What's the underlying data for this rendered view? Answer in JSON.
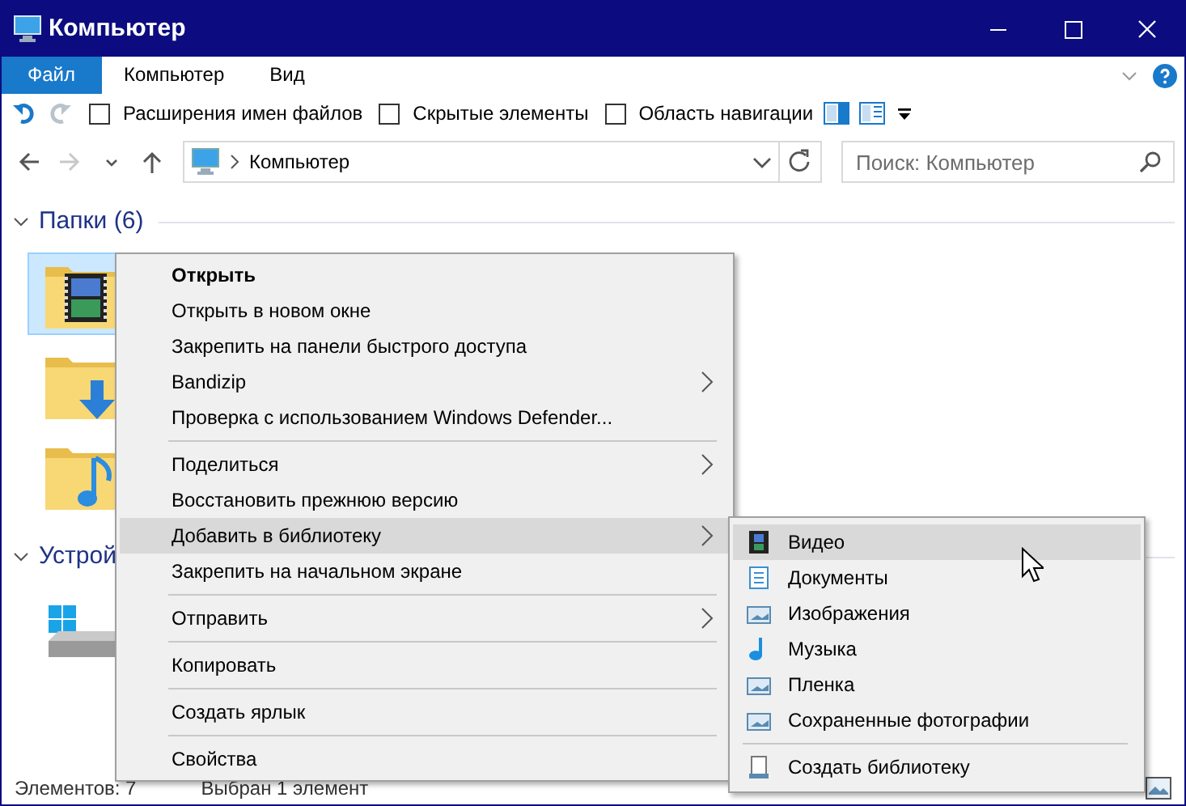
{
  "window": {
    "title": "Компьютер"
  },
  "ribbon_tabs": [
    {
      "label": "Файл",
      "selected": true
    },
    {
      "label": "Компьютер",
      "selected": false
    },
    {
      "label": "Вид",
      "selected": false
    }
  ],
  "quick_actions": [
    {
      "kind": "undo",
      "disabled": false
    },
    {
      "kind": "redo",
      "disabled": true
    }
  ],
  "view_options": [
    {
      "label": "Расширения имен файлов",
      "checked": false
    },
    {
      "label": "Скрытые элементы",
      "checked": false
    },
    {
      "label": "Область навигации",
      "checked": false
    }
  ],
  "nav_buttons": [
    {
      "kind": "back",
      "disabled": false
    },
    {
      "kind": "forward",
      "disabled": true
    },
    {
      "kind": "recent",
      "disabled": false
    },
    {
      "kind": "up",
      "disabled": false
    }
  ],
  "address": {
    "path": "Компьютер"
  },
  "search": {
    "placeholder": "Поиск: Компьютер"
  },
  "groups": [
    {
      "title": "Папки (6)",
      "items": [
        {
          "kind": "video",
          "selected": true
        },
        {
          "kind": "downloads",
          "selected": false
        },
        {
          "kind": "music",
          "selected": false
        }
      ]
    },
    {
      "title": "Устрой",
      "items": [
        {
          "kind": "drive",
          "selected": false
        }
      ]
    }
  ],
  "status_bar": {
    "count": "Элементов: 7",
    "selection": "Выбран 1 элемент"
  },
  "context_menu": [
    {
      "kind": "item",
      "label": "Открыть",
      "default": true,
      "submenu": false,
      "selected": false
    },
    {
      "kind": "item",
      "label": "Открыть в новом окне",
      "default": false,
      "submenu": false,
      "selected": false
    },
    {
      "kind": "item",
      "label": "Закрепить на панели быстрого доступа",
      "default": false,
      "submenu": false,
      "selected": false
    },
    {
      "kind": "item",
      "label": "Bandizip",
      "default": false,
      "submenu": true,
      "selected": false
    },
    {
      "kind": "item",
      "label": "Проверка с использованием Windows Defender...",
      "default": false,
      "submenu": false,
      "selected": false
    },
    {
      "kind": "separator"
    },
    {
      "kind": "item",
      "label": "Поделиться",
      "default": false,
      "submenu": true,
      "selected": false
    },
    {
      "kind": "item",
      "label": "Восстановить прежнюю версию",
      "default": false,
      "submenu": false,
      "selected": false
    },
    {
      "kind": "item",
      "label": "Добавить в библиотеку",
      "default": false,
      "submenu": true,
      "selected": true
    },
    {
      "kind": "item",
      "label": "Закрепить на начальном экране",
      "default": false,
      "submenu": false,
      "selected": false
    },
    {
      "kind": "separator"
    },
    {
      "kind": "item",
      "label": "Отправить",
      "default": false,
      "submenu": true,
      "selected": false
    },
    {
      "kind": "separator"
    },
    {
      "kind": "item",
      "label": "Копировать",
      "default": false,
      "submenu": false,
      "selected": false
    },
    {
      "kind": "separator"
    },
    {
      "kind": "item",
      "label": "Создать ярлык",
      "default": false,
      "submenu": false,
      "selected": false
    },
    {
      "kind": "separator"
    },
    {
      "kind": "item",
      "label": "Свойства",
      "default": false,
      "submenu": false,
      "selected": false
    }
  ],
  "library_submenu": [
    {
      "kind": "video",
      "label": "Видео",
      "selected": true
    },
    {
      "kind": "documents",
      "label": "Документы",
      "selected": false
    },
    {
      "kind": "pictures",
      "label": "Изображения",
      "selected": false
    },
    {
      "kind": "music",
      "label": "Музыка",
      "selected": false
    },
    {
      "kind": "pictures",
      "label": "Пленка",
      "selected": false
    },
    {
      "kind": "pictures",
      "label": "Сохраненные фотографии",
      "selected": false
    },
    {
      "kind": "separator"
    },
    {
      "kind": "new-library",
      "label": "Создать библиотеку",
      "selected": false
    }
  ]
}
